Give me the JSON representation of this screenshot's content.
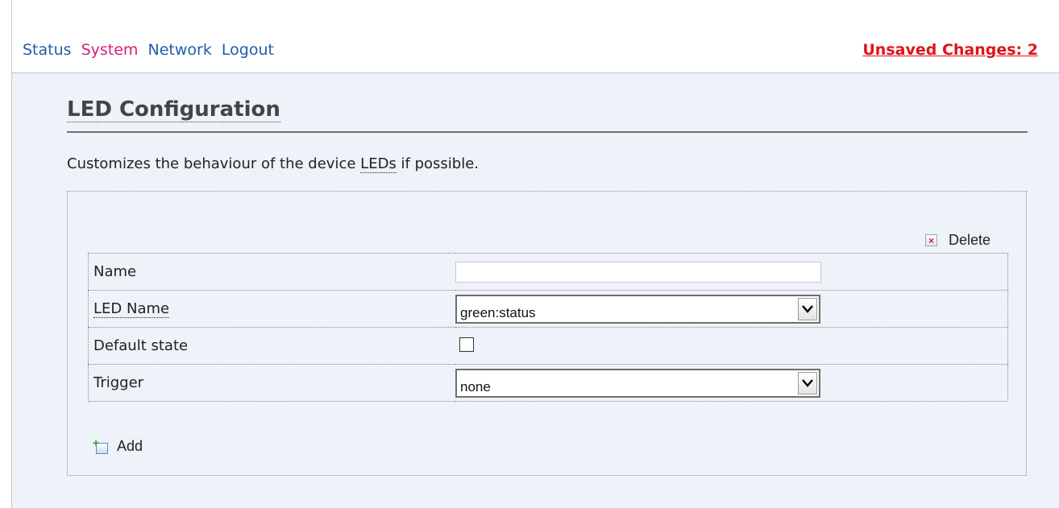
{
  "nav": {
    "items": [
      {
        "label": "Status",
        "active": false
      },
      {
        "label": "System",
        "active": true
      },
      {
        "label": "Network",
        "active": false
      },
      {
        "label": "Logout",
        "active": false
      }
    ]
  },
  "unsaved": {
    "label": "Unsaved Changes: 2"
  },
  "page": {
    "title": "LED Configuration",
    "description_pre": "Customizes the behaviour of the device ",
    "description_abbr": "LEDs",
    "description_post": " if possible."
  },
  "section": {
    "delete_label": "Delete",
    "add_label": "Add",
    "fields": {
      "name": {
        "label": "Name",
        "value": "",
        "placeholder": ""
      },
      "led_name": {
        "label": "LED Name",
        "value": "green:status"
      },
      "default_state": {
        "label": "Default state",
        "checked": false
      },
      "trigger": {
        "label": "Trigger",
        "value": "none"
      }
    }
  },
  "colors": {
    "nav_link": "#1f5da8",
    "nav_active": "#d61f7a",
    "unsaved": "#e0131a",
    "content_bg": "#eef2f9"
  },
  "icons": {
    "delete": "delete-icon",
    "add": "add-icon",
    "dropdown": "chevron-down-icon"
  }
}
